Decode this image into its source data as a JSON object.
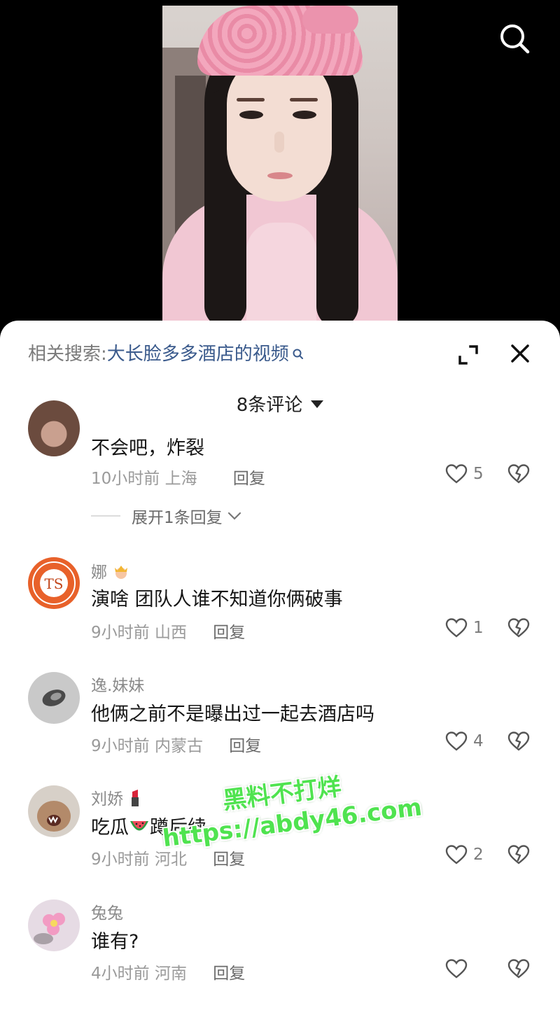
{
  "header": {
    "search_icon": "search-icon"
  },
  "sheet": {
    "related_label": "相关搜索:",
    "related_query": "大长脸多多酒店的视频",
    "comment_count": "8条评论",
    "expand_icon": "expand-icon",
    "close_icon": "close-icon"
  },
  "comments": [
    {
      "user": "",
      "text": "不会吧，炸裂",
      "time": "10小时前",
      "location": "上海",
      "reply": "回复",
      "likes": "5",
      "more_replies": "展开1条回复"
    },
    {
      "user": "娜",
      "user_emoji": "crown-emoji",
      "text": "演啥 团队人谁不知道你俩破事",
      "time": "9小时前",
      "location": "山西",
      "reply": "回复",
      "likes": "1"
    },
    {
      "user": "逸.妹妹",
      "text": "他俩之前不是曝出过一起去酒店吗",
      "time": "9小时前",
      "location": "内蒙古",
      "reply": "回复",
      "likes": "4"
    },
    {
      "user": "刘娇",
      "user_emoji": "lipstick-emoji",
      "text_before": "吃瓜",
      "text_emoji": "watermelon-emoji",
      "text_after": "蹲后续",
      "time": "9小时前",
      "location": "河北",
      "reply": "回复",
      "likes": "2"
    },
    {
      "user": "兔兔",
      "text": "谁有?",
      "time": "4小时前",
      "location": "河南",
      "reply": "回复",
      "likes": ""
    }
  ],
  "watermark": {
    "line1": "黑料不打烊",
    "line2": "https://abdy46.com"
  },
  "colors": {
    "link_blue": "#3a5a8c",
    "watermark_green": "#4fe34f"
  }
}
